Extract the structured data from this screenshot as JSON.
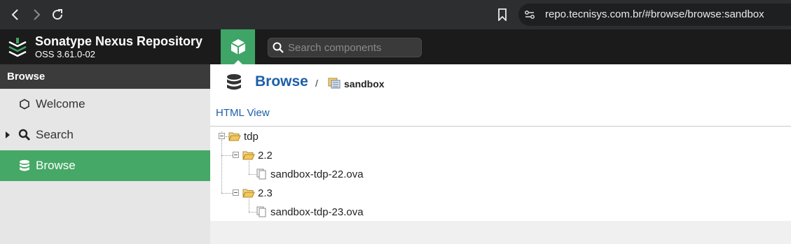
{
  "browser": {
    "url": "repo.tecnisys.com.br/#browse/browse:sandbox"
  },
  "header": {
    "title": "Sonatype Nexus Repository",
    "version": "OSS 3.61.0-02",
    "search_placeholder": "Search components"
  },
  "sidebar": {
    "section_title": "Browse",
    "items": [
      {
        "label": "Welcome",
        "icon": "hexagon-icon"
      },
      {
        "label": "Search",
        "icon": "magnifier-icon"
      },
      {
        "label": "Browse",
        "icon": "database-icon"
      }
    ]
  },
  "main": {
    "breadcrumb_title": "Browse",
    "breadcrumb_sep": "/",
    "repository": "sandbox",
    "html_view_label": "HTML View",
    "tree": {
      "root": "tdp",
      "folders": [
        {
          "name": "2.2",
          "file": "sandbox-tdp-22.ova"
        },
        {
          "name": "2.3",
          "file": "sandbox-tdp-23.ova"
        }
      ]
    }
  },
  "colors": {
    "accent_green": "#46a866",
    "link_blue": "#1d5fa8",
    "header_dark": "#1b1b1b"
  }
}
